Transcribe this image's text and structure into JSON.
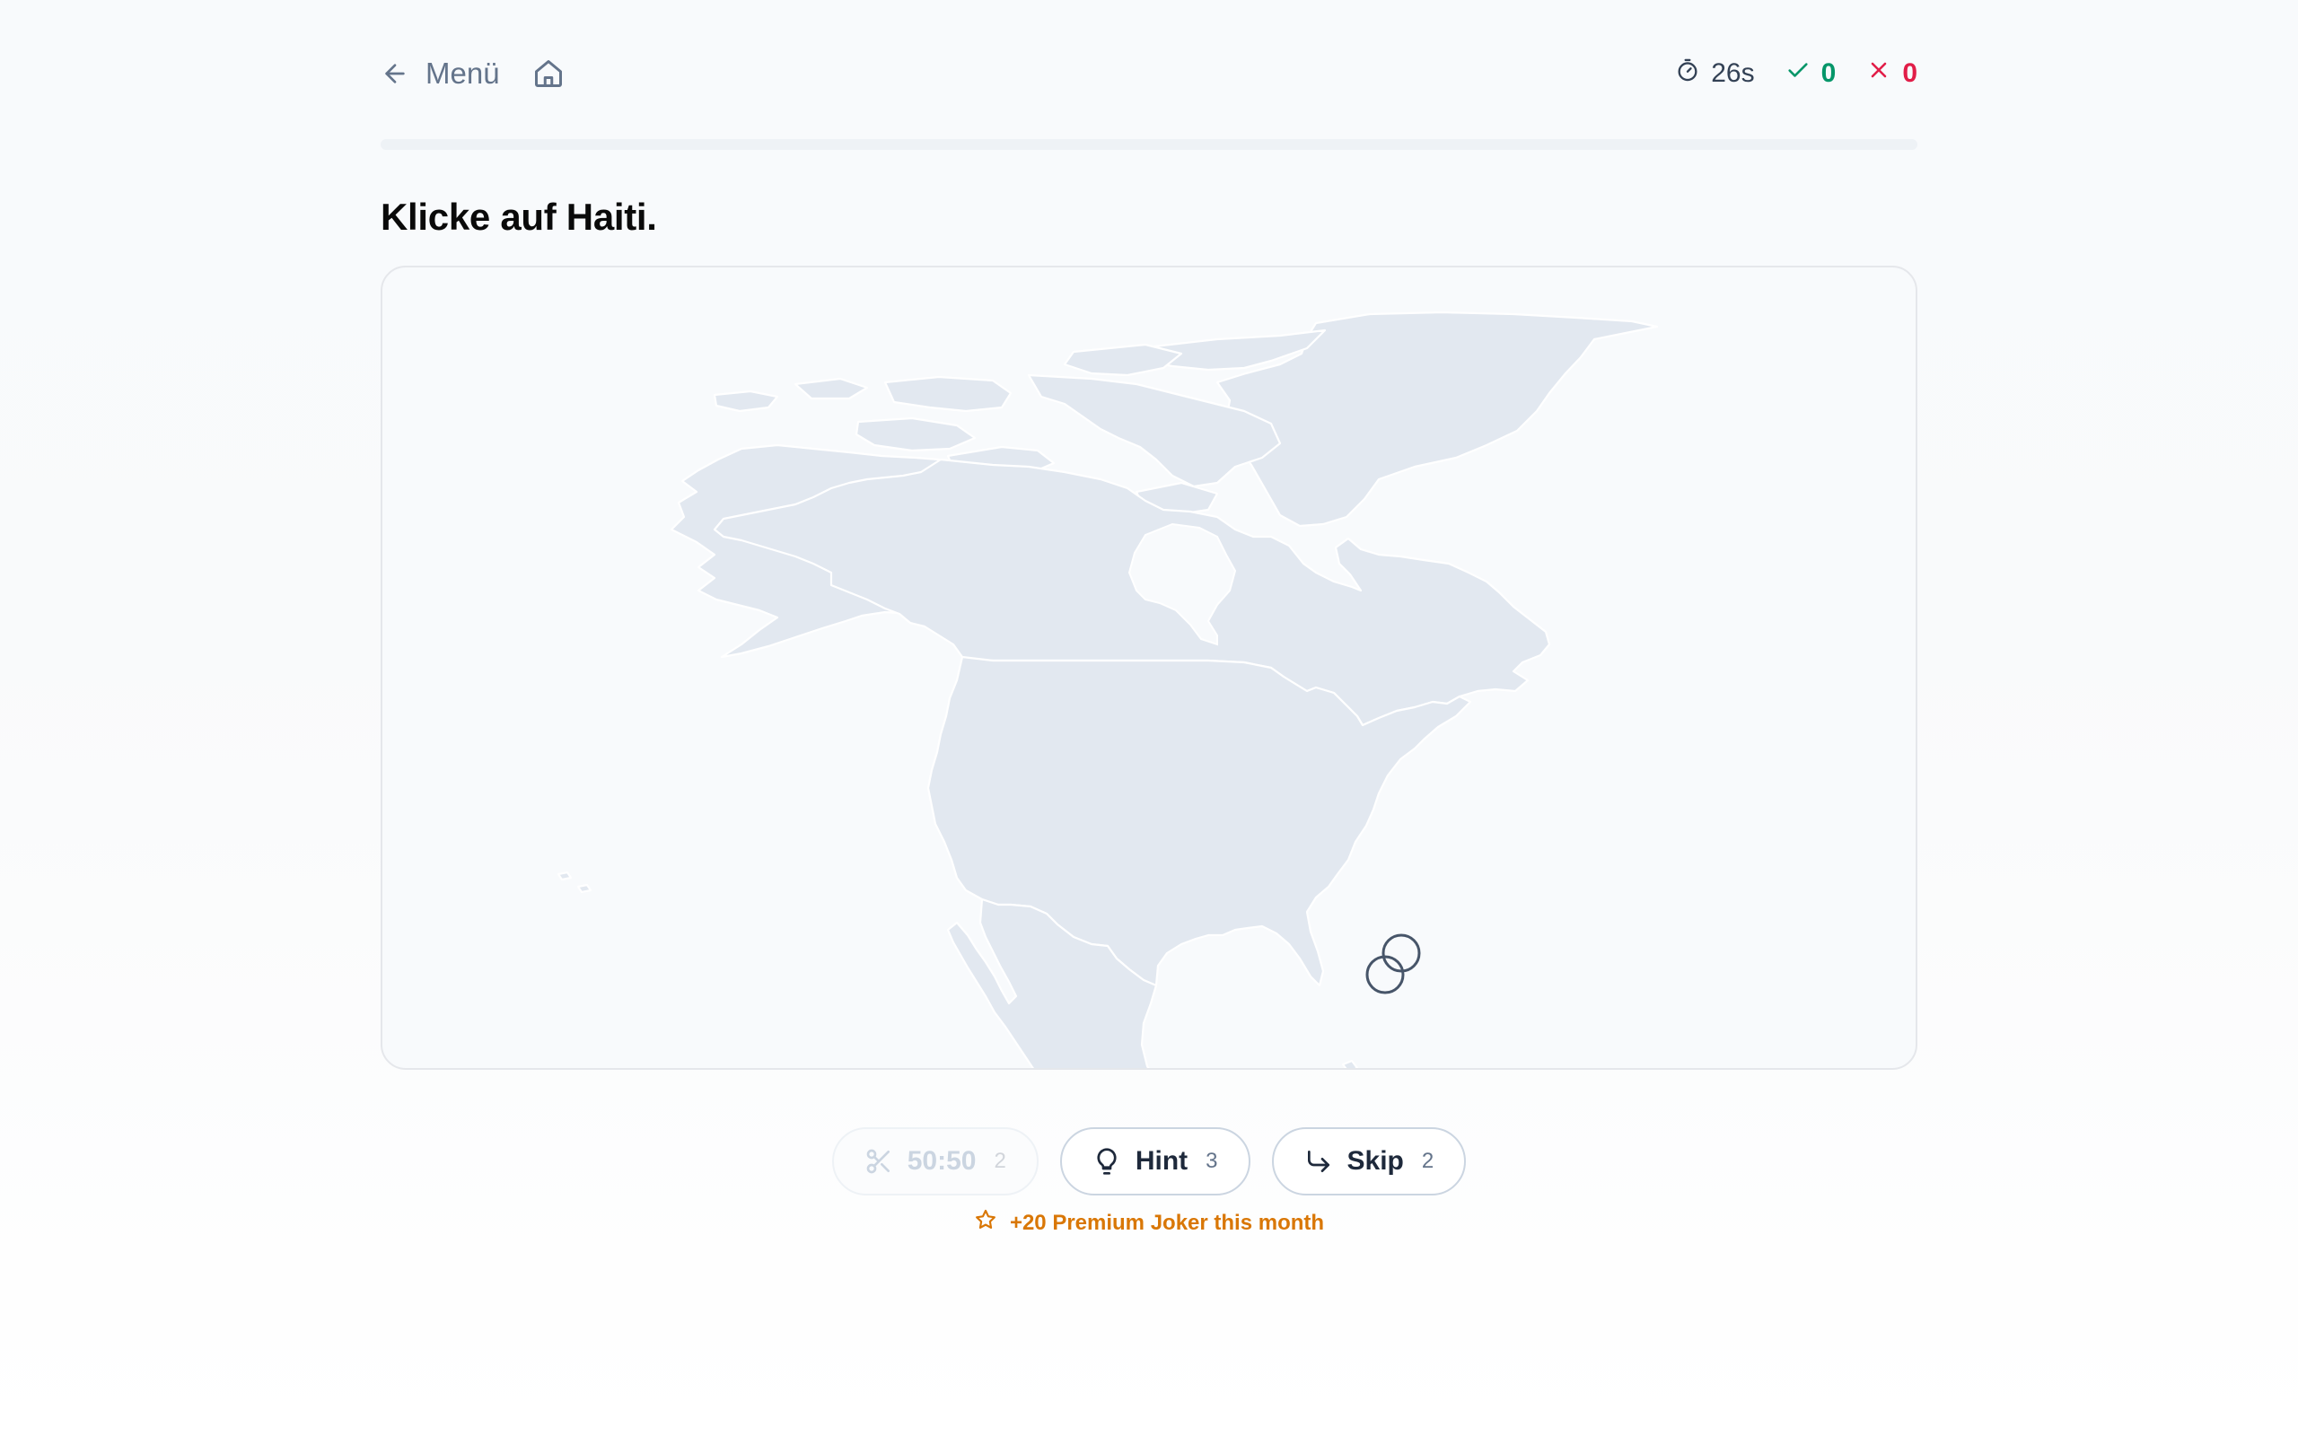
{
  "header": {
    "back_label": "Menü",
    "timer": "26s",
    "correct_count": "0",
    "wrong_count": "0"
  },
  "progress": {
    "fraction": 0
  },
  "prompt": "Klicke auf Haiti.",
  "jokers": [
    {
      "icon": "scissors-icon",
      "label": "50:50",
      "count": "2",
      "enabled": false
    },
    {
      "icon": "lightbulb-icon",
      "label": "Hint",
      "count": "3",
      "enabled": true
    },
    {
      "icon": "redo-arrow-icon",
      "label": "Skip",
      "count": "2",
      "enabled": true
    }
  ],
  "premium_note": "+20 Premium Joker this month",
  "colors": {
    "land": "#e2e8f0",
    "border": "#ffffff",
    "correct": "#059669",
    "wrong": "#e11d48",
    "premium": "#d97706"
  }
}
